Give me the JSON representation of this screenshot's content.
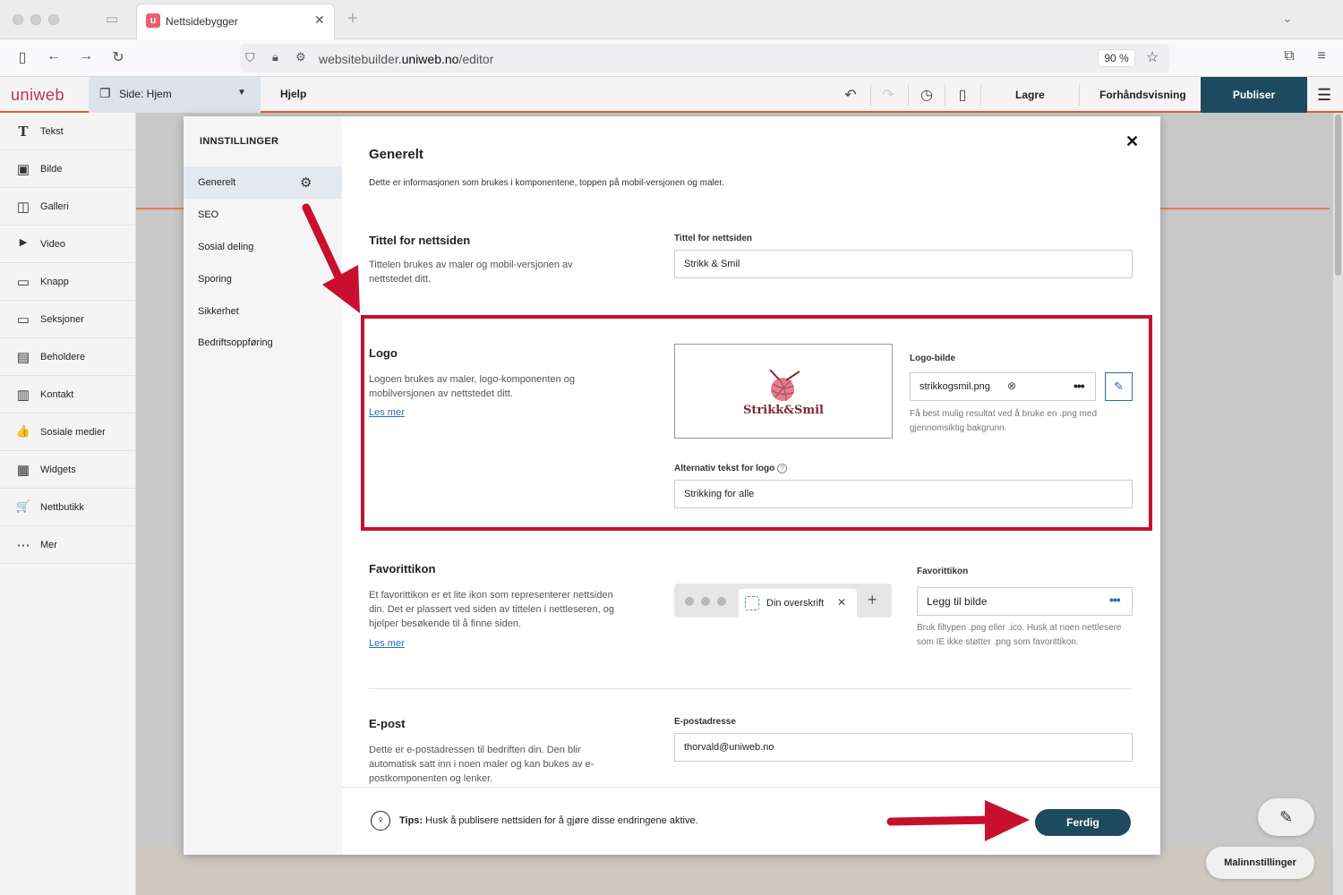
{
  "browser": {
    "tab_title": "Nettsidebygger",
    "tab_favicon": "u",
    "url_prefix": "websitebuilder.",
    "url_domain": "uniweb.no",
    "url_path": "/editor",
    "zoom": "90 %"
  },
  "app": {
    "logo": "uniweb",
    "page_selector": "Side: Hjem",
    "help": "Hjelp",
    "save": "Lagre",
    "preview": "Forhåndsvisning",
    "publish": "Publiser",
    "accent_color": "#1d4a5e",
    "brand_color": "#c0344c"
  },
  "sidebar": {
    "items": [
      {
        "label": "Tekst",
        "icon": "T"
      },
      {
        "label": "Bilde",
        "icon": "▣"
      },
      {
        "label": "Galleri",
        "icon": "◫"
      },
      {
        "label": "Video",
        "icon": "▶"
      },
      {
        "label": "Knapp",
        "icon": "▭"
      },
      {
        "label": "Seksjoner",
        "icon": "▭"
      },
      {
        "label": "Beholdere",
        "icon": "▤"
      },
      {
        "label": "Kontakt",
        "icon": "▥"
      },
      {
        "label": "Sosiale medier",
        "icon": "👍"
      },
      {
        "label": "Widgets",
        "icon": "▦"
      },
      {
        "label": "Nettbutikk",
        "icon": "🛒"
      },
      {
        "label": "Mer",
        "icon": "⋯"
      }
    ]
  },
  "settings": {
    "nav_title": "INNSTILLINGER",
    "nav_items": [
      "Generelt",
      "SEO",
      "Sosial deling",
      "Sporing",
      "Sikkerhet",
      "Bedriftsoppføring"
    ],
    "active_item": "Generelt",
    "heading": "Generelt",
    "intro": "Dette er informasjonen som brukes i komponentene, toppen på mobil-versjonen og maler.",
    "title_section": {
      "heading": "Tittel for nettsiden",
      "description": "Tittelen brukes av maler og mobil-versjonen av nettstedet ditt.",
      "field_label": "Tittel for nettsiden",
      "field_value": "Strikk & Smil"
    },
    "logo_section": {
      "heading": "Logo",
      "description": "Logoen brukes av maler, logo-komponenten og mobilversjonen av nettstedet ditt.",
      "link": "Les mer",
      "preview_text": "Strikk&Smil",
      "file_label": "Logo-bilde",
      "file_name": "strikkogsmil.png",
      "file_hint": "Få best mulig resultat ved å bruke en .png med gjennomsiktig bakgrunn.",
      "alt_label": "Alternativ tekst for logo",
      "alt_value": "Strikking for alle"
    },
    "favicon_section": {
      "heading": "Favorittikon",
      "description": "Et favorittikon er et lite ikon som representerer nettsiden din. Det er plassert ved siden av tittelen i nettleseren, og hjelper besøkende til å finne siden.",
      "link": "Les mer",
      "preview_tab": "Din overskrift",
      "field_label": "Favorittikon",
      "field_value": "Legg til bilde",
      "hint": "Bruk filtypen .png eller .ico. Husk at noen nettlesere som IE ikke støtter .png som favorittikon."
    },
    "email_section": {
      "heading": "E-post",
      "description": "Dette er e-postadressen til bedriften din. Den blir automatisk satt inn i noen maler og kan bukes av e-postkomponenten og lenker.",
      "field_label": "E-postadresse",
      "field_value": "thorvald@uniweb.no"
    },
    "tips_label": "Tips:",
    "tips_text": " Husk å publisere nettsiden for å gjøre disse endringene aktive.",
    "done": "Ferdig"
  },
  "floating": {
    "template_settings": "Malinnstillinger"
  }
}
